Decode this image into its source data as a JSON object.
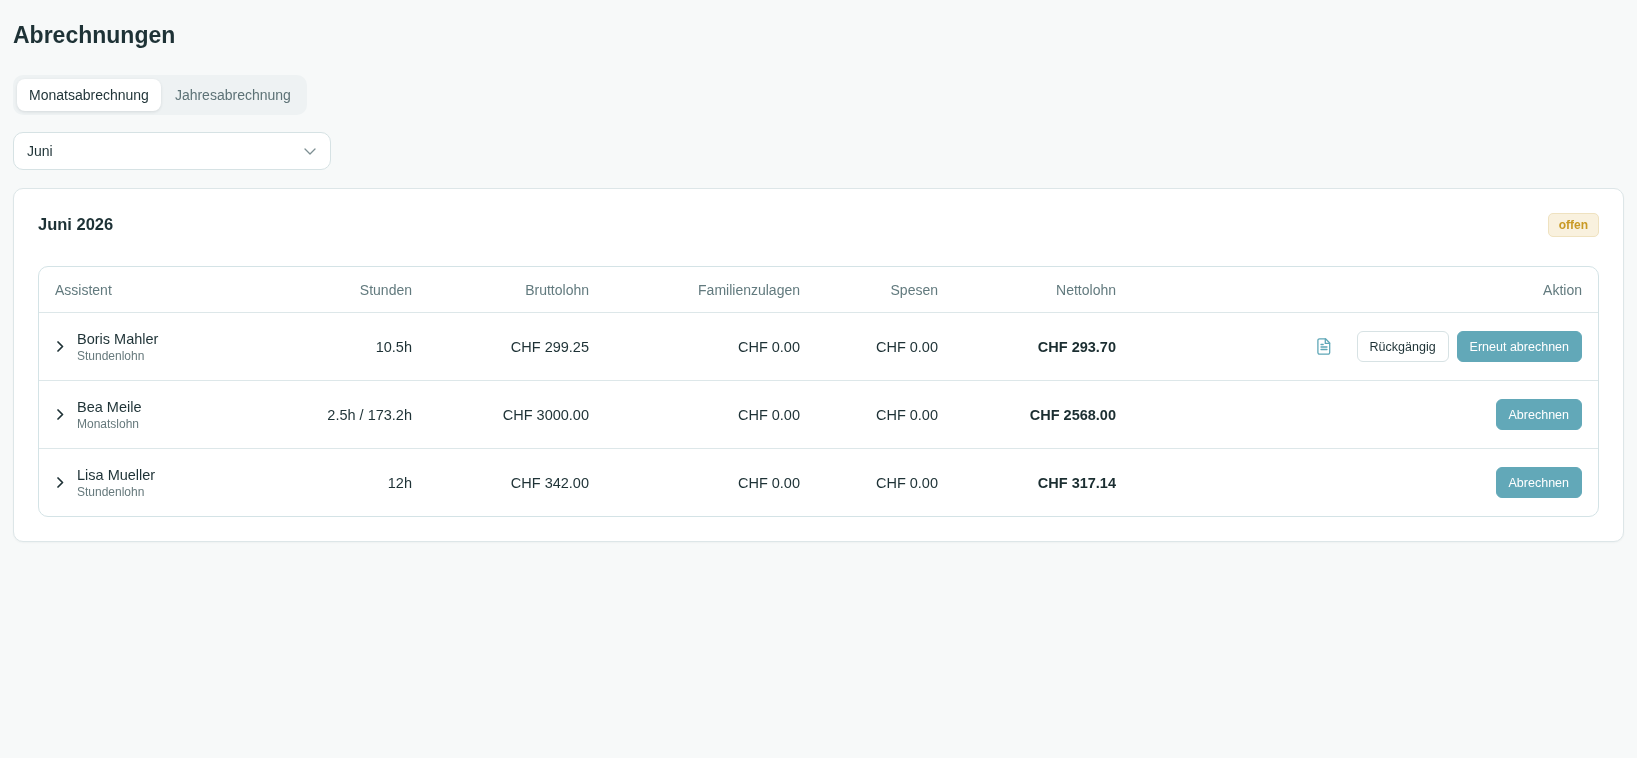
{
  "page": {
    "title": "Abrechnungen"
  },
  "tabs": [
    {
      "label": "Monatsabrechnung",
      "selected": true
    },
    {
      "label": "Jahresabrechnung",
      "selected": false
    }
  ],
  "month_select": {
    "value": "Juni"
  },
  "period": {
    "title": "Juni 2026",
    "status": "offen"
  },
  "table": {
    "columns": [
      "Assistent",
      "Stunden",
      "Bruttolohn",
      "Familienzulagen",
      "Spesen",
      "Nettolohn",
      "Aktion"
    ],
    "rows": [
      {
        "name": "Boris Mahler",
        "wage_type": "Stundenlohn",
        "expanded": false,
        "hours": "10.5h",
        "gross": "CHF 299.25",
        "family_allowance": "CHF 0.00",
        "expenses": "CHF 0.00",
        "net": "CHF 293.70",
        "actions": [
          {
            "kind": "icon"
          },
          {
            "kind": "secondary",
            "label": "Rückgängig"
          },
          {
            "kind": "primary",
            "label": "Erneut abrechnen"
          }
        ]
      },
      {
        "name": "Bea Meile",
        "wage_type": "Monatslohn",
        "expanded": false,
        "hours": "2.5h / 173.2h",
        "gross": "CHF 3000.00",
        "family_allowance": "CHF 0.00",
        "expenses": "CHF 0.00",
        "net": "CHF 2568.00",
        "actions": [
          {
            "kind": "primary",
            "label": "Abrechnen"
          }
        ]
      },
      {
        "name": "Lisa Mueller",
        "wage_type": "Stundenlohn",
        "expanded": false,
        "hours": "12h",
        "gross": "CHF 342.00",
        "family_allowance": "CHF 0.00",
        "expenses": "CHF 0.00",
        "net": "CHF 317.14",
        "actions": [
          {
            "kind": "primary",
            "label": "Abrechnen"
          }
        ]
      }
    ]
  }
}
